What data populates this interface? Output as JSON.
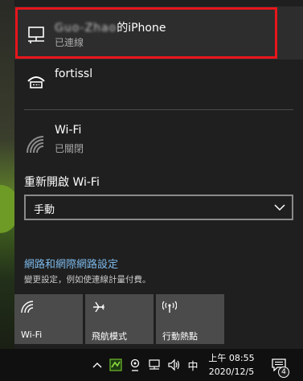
{
  "networks": [
    {
      "name_redacted": "Guo-Zhao",
      "name_suffix": "的iPhone",
      "status": "已連線",
      "icon": "ethernet-icon"
    },
    {
      "name": "fortissl",
      "icon": "vpn-dialup-icon"
    },
    {
      "name": "Wi-Fi",
      "status": "已關閉",
      "icon": "wifi-icon"
    }
  ],
  "wifi_restart": {
    "label": "重新開啟 Wi-Fi",
    "selected": "手動"
  },
  "settings": {
    "link": "網路和網際網路設定",
    "description": "變更設定，例如使連線計量付費。"
  },
  "quick_actions": [
    {
      "label": "Wi-Fi",
      "icon": "wifi-icon"
    },
    {
      "label": "飛航模式",
      "icon": "airplane-icon"
    },
    {
      "label": "行動熱點",
      "icon": "hotspot-icon"
    }
  ],
  "taskbar": {
    "ime": "中",
    "time": "上午 08:55",
    "date": "2020/12/5",
    "notification_count": "4"
  },
  "colors": {
    "highlight": "#e8161b",
    "link": "#7cb9ea",
    "panel": "#1f1f1f",
    "tile": "#4b4b4b"
  }
}
